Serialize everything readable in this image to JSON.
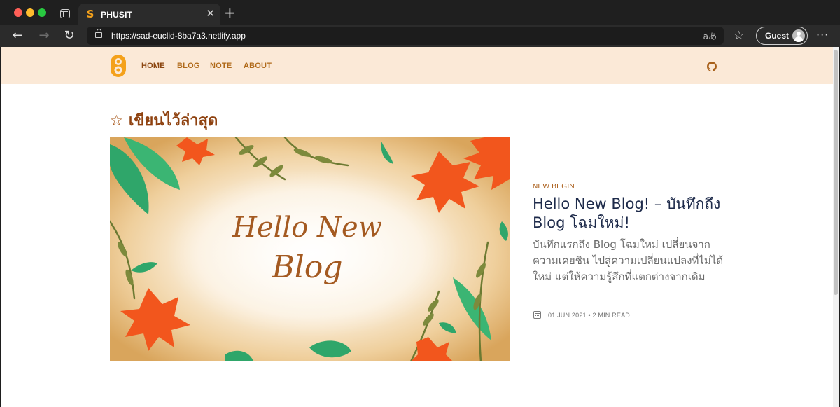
{
  "browser": {
    "tab_title": "PHUSIT",
    "tab_favicon": "S",
    "url": "https://sad-euclid-8ba7a3.netlify.app",
    "profile_label": "Guest",
    "readaloud_glyph": "aあ",
    "icons": [
      "tab-actions-icon",
      "close-icon",
      "new-tab-icon",
      "back-icon",
      "forward-icon",
      "reload-icon",
      "lock-icon",
      "read-aloud-icon",
      "favorites-icon",
      "avatar",
      "more-icon"
    ]
  },
  "site": {
    "nav": [
      {
        "label": "HOME",
        "active": true
      },
      {
        "label": "BLOG",
        "active": false
      },
      {
        "label": "NOTE",
        "active": false
      },
      {
        "label": "ABOUT",
        "active": false
      }
    ],
    "header_bg": "#fbe9d7",
    "accent": "#8f4210"
  },
  "section": {
    "title": "เขียนไว้ล่าสุด"
  },
  "post": {
    "image_text_line1": "Hello New",
    "image_text_line2": "Blog",
    "tag": "NEW BEGIN",
    "title": "Hello New Blog! – บันทึกถึง Blog โฉมใหม่!",
    "excerpt": "บันทึกแรกถึง Blog โฉมใหม่ เปลี่ยนจากความเคยชิน ไปสู่ความเปลี่ยนแปลงที่ไม่ได้ใหม่ แต่ให้ความรู้สึกที่แตกต่างจากเดิม",
    "meta": "01 JUN 2021 • 2 MIN READ"
  }
}
